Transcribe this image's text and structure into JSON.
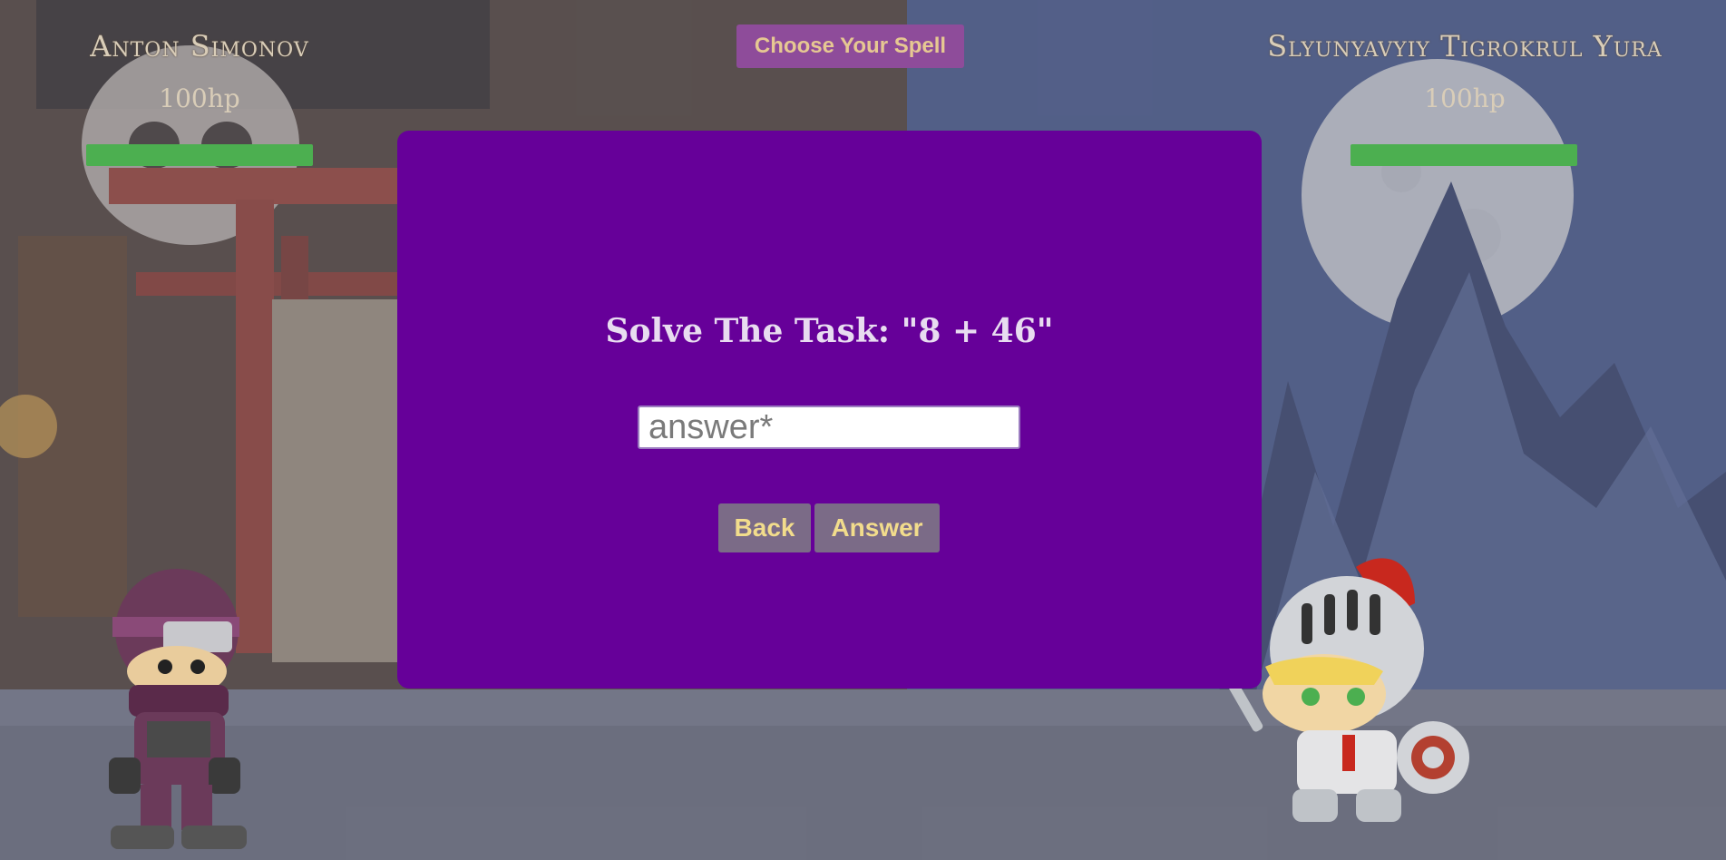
{
  "player_left": {
    "name": "Anton Simonov",
    "hp_label": "100hp",
    "hp_fraction": 1.0
  },
  "player_right": {
    "name": "Slyunyavyiy Tigrokrul Yura",
    "hp_label": "100hp",
    "hp_fraction": 1.0
  },
  "spell_button_label": "Choose Your Spell",
  "modal": {
    "task_text": "Solve The Task: \"8 + 46\"",
    "answer_placeholder": "answer*",
    "back_label": "Back",
    "answer_label": "Answer"
  },
  "colors": {
    "modal_bg": "#660099",
    "hp_bar": "#4caf50",
    "spell_button_bg": "#8e4c9a",
    "modal_button_bg": "#7b6b87",
    "modal_button_text": "#f2dc8c"
  },
  "scene": {
    "left_background": "temple-gate-with-skull",
    "right_background": "moonlit-mountains",
    "left_character_icon": "ninja-character-icon",
    "right_character_icon": "knight-character-icon"
  }
}
